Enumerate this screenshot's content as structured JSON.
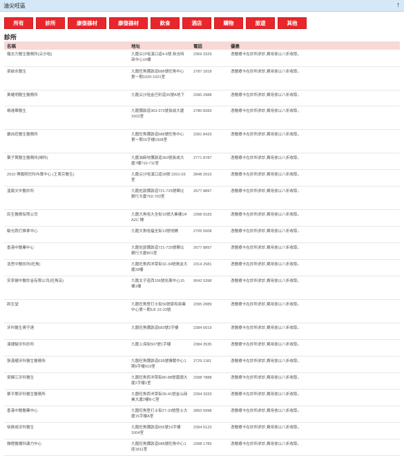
{
  "header": {
    "title": "油尖旺區",
    "collapse_icon": "up-arrow-icon"
  },
  "tabs": [
    {
      "label": "所有"
    },
    {
      "label": "診所"
    },
    {
      "label": "康復器材"
    },
    {
      "label": "康復器材"
    },
    {
      "label": "飲食"
    },
    {
      "label": "酒店"
    },
    {
      "label": "購物"
    },
    {
      "label": "旅遊"
    },
    {
      "label": "其他"
    }
  ],
  "section_title": "診所",
  "table": {
    "columns": [
      "名稱",
      "地址",
      "電話",
      "優惠"
    ],
    "rows": [
      {
        "name": "羅志力醫生醫務所(尖沙咀)",
        "address": "九龍尖沙咀漢口道4-6號 新吉時商中心10樓",
        "phone": "2369 3329",
        "offer": "憑醫療卡在診所求診,費用會以八折收取。"
      },
      {
        "name": "梁啟永醫生",
        "address": "九龍旺角彌敦道688號旺角中心第一期1020-1021室",
        "phone": "2787 1818",
        "offer": "憑醫療卡在診所求診,費用會以八折收取。"
      },
      {
        "name": "黃耀明醫生醫務所",
        "address": "九龍尖沙咀金巴利道35號A地下",
        "phone": "2390 2988",
        "offer": "憑醫療卡在診所求診,費用會以八折收取。"
      },
      {
        "name": "楊達華醫生",
        "address": "九龍彌敦道363-373號長成大廈1503室",
        "phone": "2780 8283",
        "offer": "憑醫療卡在診所求診,費用會以八折收取。"
      },
      {
        "name": "嚴自莊醫生醫務所",
        "address": "九龍旺角彌敦道688號旺角中心第一期15字樓1508室",
        "phone": "2391 8433",
        "offer": "憑醫療卡在診所求診,費用會以八折收取。"
      },
      {
        "name": "葉子賢醫生醫務所(婦科)",
        "address": "九龍油麻地彌敦道363號長成大廈7樓710-711室",
        "phone": "2771 8787",
        "offer": "憑醫療卡在診所求診,費用會以八折收取。"
      },
      {
        "name": "2010 傅鳳翔兒科內專中心 (王貴芬醫生)",
        "address": "九龍尖沙咀漢口道28號 2201-03室",
        "phone": "2848 2010",
        "offer": "憑醫療卡在診所求診,費用會以八折收取。"
      },
      {
        "name": "溫鳳文中醫診所",
        "address": "九龍佐敦彌敦道721-725號華比銀行大廈702-703室",
        "phone": "2677 8897",
        "offer": "憑醫療卡在診所求診,費用會以八折收取。"
      },
      {
        "name": "民生醫療有限公司",
        "address": "九龍大角咀大全街10號大業樓1/F A2C 鋪",
        "phone": "2398 9183",
        "offer": "憑醫療卡在診所求診,費用會以八折收取。"
      },
      {
        "name": "敏光跌打推拿中心",
        "address": "九龍大角咀福全街13號地鋪",
        "phone": "2705 5508",
        "offer": "憑醫療卡在診所求診,費用會以八折收取。"
      },
      {
        "name": "香港中醫藥中心",
        "address": "九龍佐敦彌敦道721-725號華比銀行大廈801室",
        "phone": "2677 8897",
        "offer": "憑醫療卡在診所求診,費用會以八折收取。"
      },
      {
        "name": "浩思中醫診所(旺角)",
        "address": "九龍旺角西洋菜街32-34號黃金大廈28樓",
        "phone": "2314 2581",
        "offer": "憑醫療卡在診所求診,費用會以八折收取。"
      },
      {
        "name": "安寧健中醫診金有限公司(旺角店)",
        "address": "九龍太子道西156號兆萬中心15樓1樓",
        "phone": "9042 5398",
        "offer": "憑醫療卡在診所求診,費用會以八折收取。"
      },
      {
        "name": "將生堂",
        "address": "九龍旺角登打士街56號家和商業中心第一期1/F 22-23號",
        "phone": "2395 2889",
        "offer": "憑醫療卡在診所求診,費用會以八折收取。"
      },
      {
        "name": "牙科醫生黃守遠",
        "address": "九龍旺角彌敦道683號2字樓",
        "phone": "2384 0019",
        "offer": "憑醫療卡在診所求診,費用會以八折收取。"
      },
      {
        "name": "演捷駿牙科診所",
        "address": "九龍上海街507號1字樓",
        "phone": "2384 3535",
        "offer": "憑醫療卡在診所求診,費用會以八折收取。"
      },
      {
        "name": "張漢權牙科醫生醫務所",
        "address": "九龍旺角彌敦道639號雅蘭中心1期9字樓919室",
        "phone": "2729 1181",
        "offer": "憑醫療卡在診所求診,費用會以八折收取。"
      },
      {
        "name": "梁錦江牙科醫生",
        "address": "九龍旺角西洋菜街80-88號嘉順大廈2字樓1室",
        "phone": "2398 7888",
        "offer": "憑醫療卡在診所求診,費用會以八折收取。"
      },
      {
        "name": "蔡平蘭牙科醫生醫務所",
        "address": "九龍旺角西洋菜街39-41號金山商業大廈2樓B-C室",
        "phone": "2394 3333",
        "offer": "憑醫療卡在診所求診,費用會以八折收取。"
      },
      {
        "name": "香港中醫醫藥中心",
        "address": "九龍旺角登打士街27-33號登士大廈15字樓A室",
        "phone": "2850 5998",
        "offer": "憑醫療卡在診所求診,費用會以八折收取。"
      },
      {
        "name": "徐振成牙科醫生",
        "address": "九龍旺角彌敦道655號10字樓1004室",
        "phone": "2394 5123",
        "offer": "憑醫療卡在診所求診,費用會以八折收取。"
      },
      {
        "name": "雅橙醫護科康力中心",
        "address": "九龍旺角彌敦道688號旺角中心1座1811室",
        "phone": "2398 1785",
        "offer": "憑醫療卡在診所求診,費用會以八折收取。"
      }
    ]
  }
}
